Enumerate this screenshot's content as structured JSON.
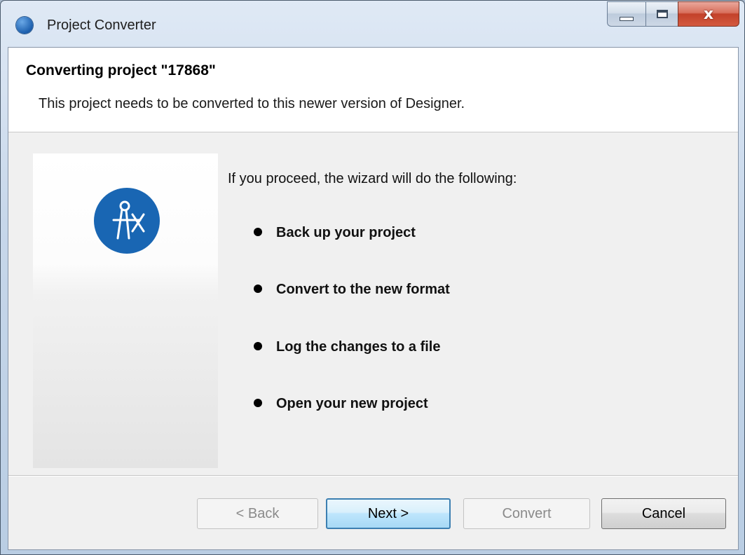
{
  "window": {
    "title": "Project Converter",
    "icon": "app-compass-icon",
    "controls": {
      "minimize": "minimize-icon",
      "maximize": "maximize-icon",
      "close_glyph": "x"
    }
  },
  "header": {
    "title": "Converting project \"17868\"",
    "description": "This project needs to be converted to this newer version of Designer."
  },
  "body": {
    "intro": "If you proceed, the wizard will do the following:",
    "steps": [
      "Back up your project",
      "Convert to the new format",
      "Log the changes to a file",
      "Open your new project"
    ]
  },
  "buttons": {
    "back": {
      "label": "< Back",
      "enabled": false
    },
    "next": {
      "label": "Next >",
      "enabled": true,
      "default": true
    },
    "convert": {
      "label": "Convert",
      "enabled": false
    },
    "cancel": {
      "label": "Cancel",
      "enabled": true
    }
  },
  "colors": {
    "logo_blue": "#1966b3",
    "default_button_border": "#3c7fb1",
    "close_button": "#c2412a"
  }
}
